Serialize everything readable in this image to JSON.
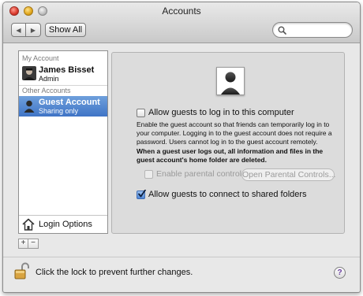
{
  "window": {
    "title": "Accounts"
  },
  "toolbar": {
    "back_glyph": "◀",
    "forward_glyph": "▶",
    "show_all_label": "Show All",
    "search_value": "",
    "search_placeholder": ""
  },
  "sidebar": {
    "my_account_header": "My Account",
    "other_accounts_header": "Other Accounts",
    "users": [
      {
        "name": "James Bisset",
        "role": "Admin",
        "selected": false
      },
      {
        "name": "Guest Account",
        "role": "Sharing only",
        "selected": true
      }
    ],
    "login_options_label": "Login Options",
    "add_label": "+",
    "remove_label": "−"
  },
  "panel": {
    "allow_login_label": "Allow guests to log in to this computer",
    "allow_login_checked": false,
    "description": "Enable the guest account so that friends can temporarily log in to your computer. Logging in to the guest account does not require a password. Users cannot log in to the guest account remotely.",
    "warning": "When a guest user logs out, all information and files in the guest account's home folder are deleted.",
    "parental_controls_label": "Enable parental controls",
    "parental_controls_checked": false,
    "open_parental_label": "Open Parental Controls...",
    "shared_folders_label": "Allow guests to connect to shared folders",
    "shared_folders_checked": true
  },
  "footer": {
    "lock_text": "Click the lock to prevent further changes.",
    "help_label": "?"
  },
  "colors": {
    "selection": "#3f74c6",
    "help_mark": "#6a3fa0",
    "window_bg": "#e8e8e8"
  }
}
